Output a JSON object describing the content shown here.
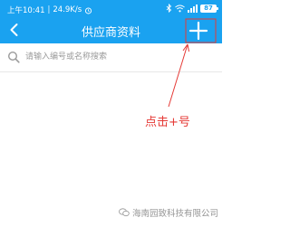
{
  "status": {
    "time": "上午10:41",
    "speed": "24.9K/s",
    "battery": "87"
  },
  "nav": {
    "title": "供应商资料",
    "add_symbol": "+"
  },
  "search": {
    "placeholder": "请输入编号或名称搜索",
    "value": ""
  },
  "annotation": {
    "text": "点击+号",
    "color": "#e53935"
  },
  "watermark": {
    "text": "海南园致科技有限公司"
  },
  "colors": {
    "accent": "#1aa2f0"
  },
  "icons": [
    "back-arrow-icon",
    "search-icon",
    "plus-icon",
    "wechat-icon"
  ]
}
